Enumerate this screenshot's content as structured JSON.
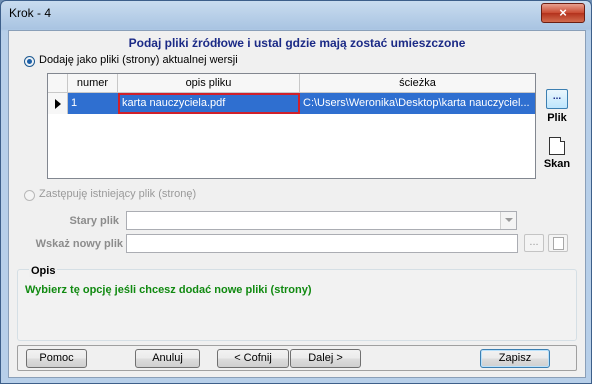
{
  "window": {
    "title": "Krok - 4",
    "close_glyph": "×"
  },
  "heading": "Podaj pliki źródłowe i ustal gdzie mają zostać umieszczone",
  "option_add": {
    "label": "Dodaję jako pliki (strony) aktualnej wersji",
    "checked": true
  },
  "grid": {
    "columns": [
      "numer",
      "opis pliku",
      "ścieżka"
    ],
    "rows": [
      {
        "numer": "1",
        "opis": "karta nauczyciela.pdf",
        "sciezka": "C:\\Users\\Weronika\\Desktop\\karta nauczyciel..."
      }
    ]
  },
  "side_buttons": {
    "browse_glyph": "...",
    "plik_label": "Plik",
    "skan_label": "Skan"
  },
  "option_replace": {
    "label": "Zastępuję istniejący plik (stronę)",
    "checked": false
  },
  "stary_plik": {
    "label": "Stary plik",
    "value": ""
  },
  "nowy_plik": {
    "label": "Wskaż nowy plik",
    "value": "",
    "browse_glyph": "..."
  },
  "opis": {
    "title": "Opis",
    "text": "Wybierz tę opcję jeśli chcesz dodać nowe pliki (strony)"
  },
  "buttons": {
    "help": "Pomoc",
    "cancel": "Anuluj",
    "back": "< Cofnij",
    "next": "Dalej >",
    "save": "Zapisz"
  },
  "colors": {
    "heading": "#1b2a86",
    "selection": "#2f6fd0",
    "opis_text": "#118a11",
    "highlight_border": "#d0202a"
  }
}
